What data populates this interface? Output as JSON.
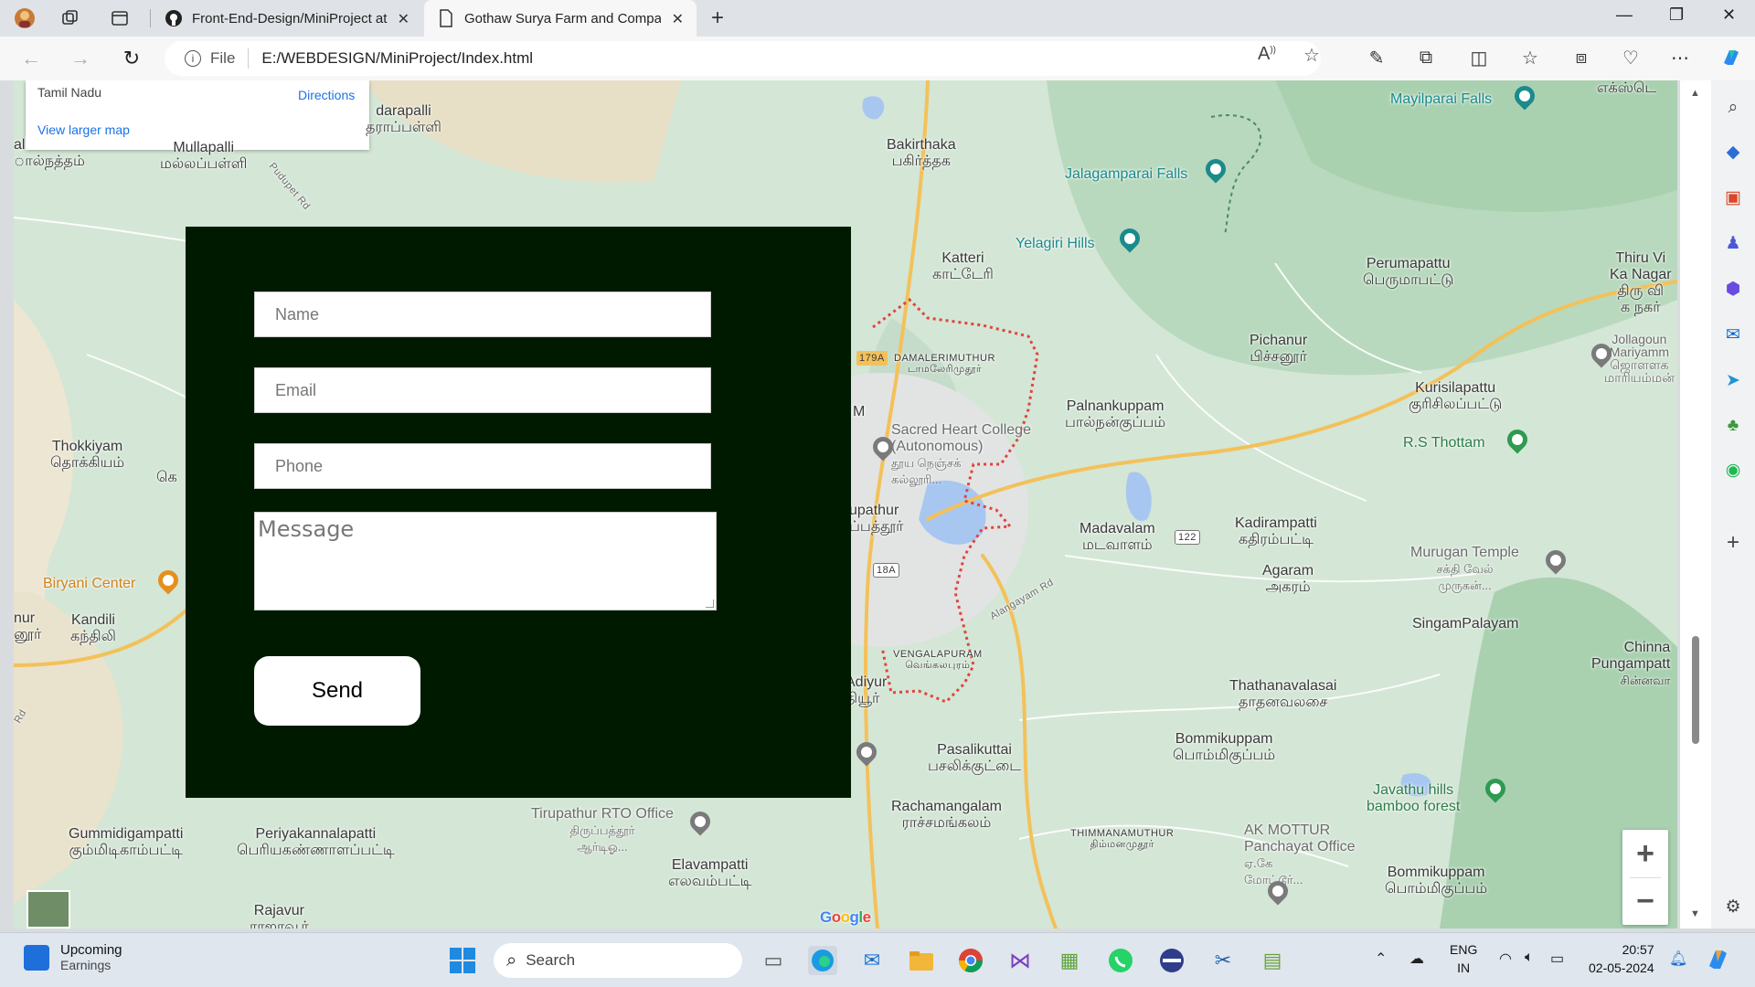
{
  "browser": {
    "tabs": [
      {
        "title": "Front-End-Design/MiniProject at",
        "icon": "github-icon",
        "active": false
      },
      {
        "title": "Gothaw Surya Farm and Compan",
        "icon": "page-icon",
        "active": true
      }
    ],
    "address": {
      "scheme": "File",
      "url": "E:/WEBDESIGN/MiniProject/Index.html"
    }
  },
  "map": {
    "card": {
      "region": "Tamil Nadu",
      "directions": "Directions",
      "larger": "View larger map"
    },
    "labels": {
      "darapalli": "darapalli",
      "darapalli_ta": "தராப்பள்ளி",
      "mallapalli": "Mullapalli",
      "mallapalli_ta": "மல்லப்பள்ளி",
      "al": "al",
      "al_ta": "ால்நத்தம்",
      "puduper": "Pudupet Rd",
      "bakirthaka": "Bakirthaka",
      "bakirthaka_ta": "பகிர்த்தக",
      "katteri": "Katteri",
      "katteri_ta": "காட்டேரி",
      "mayilparai": "Mayilparai Falls",
      "jalagamparai": "Jalagamparai Falls",
      "yelagiri": "Yelagiri Hills",
      "perumapattu": "Perumapattu",
      "perumapattu_ta": "பெருமாபட்டு",
      "thiruvi": "Thiru Vi",
      "thiruvi2": "Ka Nagar",
      "thiruvi_ta": "திரு வி",
      "thiruvi_ta2": "க நகர்",
      "pichanur": "Pichanur",
      "pichanur_ta": "பிச்சனூர்",
      "jollagoun": "Jollagoun",
      "jollagoun2": "Mariyamm",
      "jollagoun_ta": "ஜொளளக",
      "jollagoun_ta2": "மாரியம்மன்",
      "damaleri": "DAMALERIMUTHUR",
      "damaleri_ta": "டாமலேரிமுதூர்",
      "palnankuppam": "Palnankuppam",
      "palnankuppam_ta": "பால்நன்குப்பம்",
      "kurisilapattu": "Kurisilapattu",
      "kurisilapattu_ta": "குரிசிலப்பட்டு",
      "sacredheart": "Sacred Heart College",
      "sacredheart2": "(Autonomous)",
      "sacredheart_ta": "தூய நெஞ்சக்",
      "sacredheart_ta2": "கல்லூரி...",
      "rsthottam": "R.S Thottam",
      "thokkiyam": "Thokkiyam",
      "thokkiyam_ta": "தொக்கியம்",
      "tirupathur": "upathur",
      "tirupathur_ta": "ப்பத்தூர்",
      "madavalam": "Madavalam",
      "madavalam_ta": "மடவாளம்",
      "kadirampatti": "Kadirampatti",
      "kadirampatti_ta": "கதிரம்பட்டி",
      "muruganTemple": "Murugan Temple",
      "muruganTemple_ta": "சக்தி வேல்",
      "muruganTemple_ta2": "முருகன்...",
      "agaram": "Agaram",
      "agaram_ta": "அகரம்",
      "biryani": "Biryani Center",
      "nur": "nur",
      "nur_ta": "னூர்",
      "kandili": "Kandili",
      "kandili_ta": "கந்திலி",
      "singampalayam": "SingamPalayam",
      "chinnapunga": "Chinna",
      "chinnapunga2": "Pungampatt",
      "chinnapunga_ta": "சின்னவா",
      "vengalapuram": "VENGALAPURAM",
      "vengalapuram_ta": "வெங்கலபுரம்",
      "alangayam": "Alangayam Rd",
      "thathanavalasai": "Thathanavalasai",
      "thathanavalasai_ta": "தாதனவலசை",
      "adiyur": "Adiyur",
      "adiyur_ta": "தியூர்",
      "bommikuppam": "Bommikuppam",
      "bommikuppam_ta": "பொம்மிகுப்பம்",
      "pasalikuttai": "Pasalikuttai",
      "pasalikuttai_ta": "பசலிக்குட்டை",
      "javathu": "Javathu hills",
      "javathu2": "bamboo forest",
      "rachamangalam": "Rachamangalam",
      "rachamangalam_ta": "ராச்சமங்கலம்",
      "thimmanamuthur": "THIMMANAMUTHUR",
      "thimmanamuthur_ta": "திம்மனமுதூர்",
      "akmottur": "AK MOTTUR",
      "akmottur2": "Panchayat Office",
      "akmottur_ta": "ஏ.கே",
      "akmottur_ta2": "மோட்டூர்...",
      "gummidi": "Gummidigampatti",
      "gummidi_ta": "கும்மிடிகாம்பட்டி",
      "periyakan": "Periyakannalapatti",
      "periyakan_ta": "பெரியகண்ணாளப்பட்டி",
      "rto": "Tirupathur RTO Office",
      "rto_ta": "திருப்பத்தூர்",
      "rto_ta2": "ஆர்டிஓ...",
      "elavampatti": "Elavampatti",
      "elavampatti_ta": "எலவம்பட்டி",
      "bommikuppam2": "Bommikuppam",
      "bommikuppam2_ta": "பொம்மிகுப்பம்",
      "rajavur": "Rajavur",
      "rajavur_ta": "ராஜாவூர்",
      "ekstop": "எக்ஸ்டெ",
      "ke": "கெ",
      "m": "M",
      "rd": "Rd",
      "shield179": "179A",
      "shield122": "122",
      "shield18": "18A"
    },
    "google": "Google"
  },
  "form": {
    "name_placeholder": "Name",
    "email_placeholder": "Email",
    "phone_placeholder": "Phone",
    "message_placeholder": "Message",
    "send_label": "Send"
  },
  "taskbar": {
    "weather_title": "Upcoming",
    "weather_sub": "Earnings",
    "search": "Search",
    "lang1": "ENG",
    "lang2": "IN",
    "time": "20:57",
    "date": "02-05-2024"
  },
  "colors": {
    "form_bg": "#001a00",
    "link": "#1a73e8",
    "boundary": "#e0443c"
  }
}
